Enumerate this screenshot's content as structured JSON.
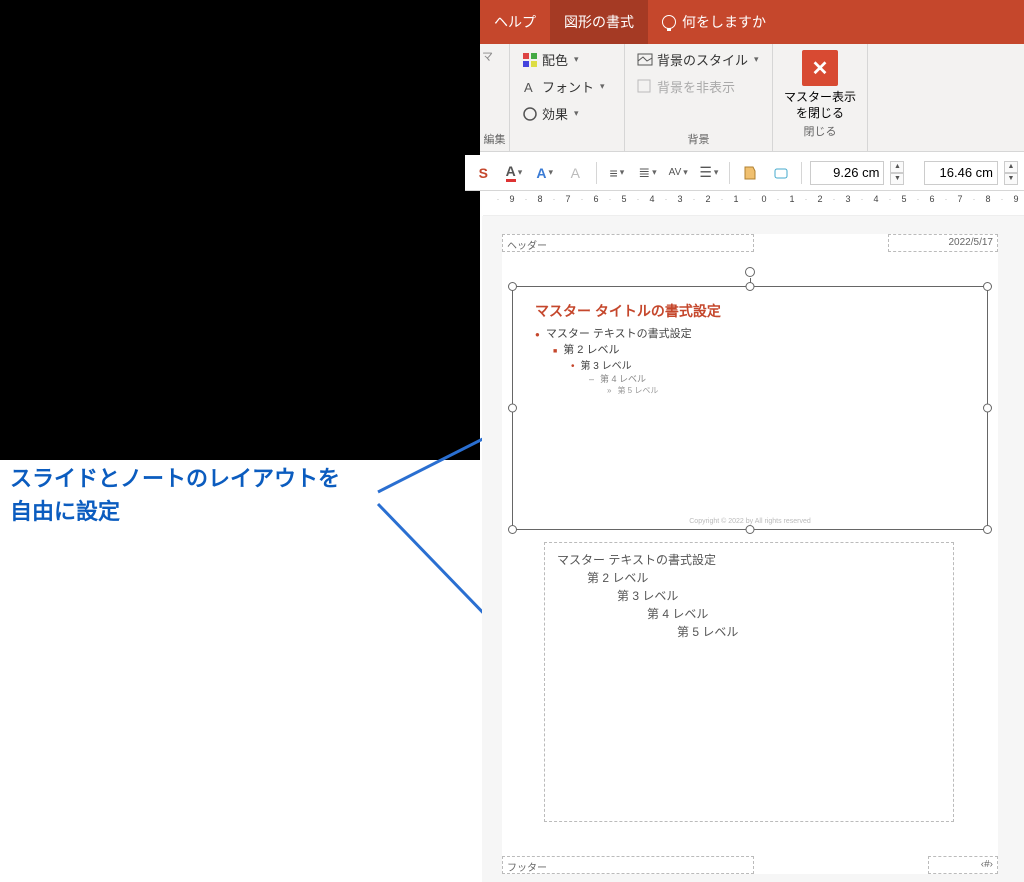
{
  "tabs": {
    "help": "ヘルプ",
    "shape_format": "図形の書式",
    "tell_me": "何をしますか"
  },
  "ribbon": {
    "colors": "配色",
    "fonts": "フォント",
    "effects": "効果",
    "bg_styles": "背景のスタイル",
    "hide_bg": "背景を非表示",
    "group_bg": "背景",
    "group_edit": "編集",
    "close_line1": "マスター表示",
    "close_line2": "を閉じる",
    "group_close": "閉じる"
  },
  "fmt": {
    "height": "9.26 cm",
    "width": "16.46 cm"
  },
  "ruler": [
    "9",
    "8",
    "7",
    "6",
    "5",
    "4",
    "3",
    "2",
    "1",
    "0",
    "1",
    "2",
    "3",
    "4",
    "5",
    "6",
    "7",
    "8",
    "9"
  ],
  "page": {
    "header": "ヘッダー",
    "date": "2022/5/17",
    "footer": "フッター",
    "pagenum": "‹#›",
    "slide_title": "マスター タイトルの書式設定",
    "slide_levels": {
      "l1": "マスター テキストの書式設定",
      "l2": "第 2 レベル",
      "l3": "第 3 レベル",
      "l4": "第 4 レベル",
      "l5": "第 5 レベル"
    },
    "copyright": "Copyright © 2022 by All rights reserved",
    "notes": {
      "l1": "マスター テキストの書式設定",
      "l2": "第 2 レベル",
      "l3": "第 3 レベル",
      "l4": "第 4 レベル",
      "l5": "第 5 レベル"
    }
  },
  "annotation": {
    "line1": "スライドとノートのレイアウトを",
    "line2": "自由に設定"
  }
}
